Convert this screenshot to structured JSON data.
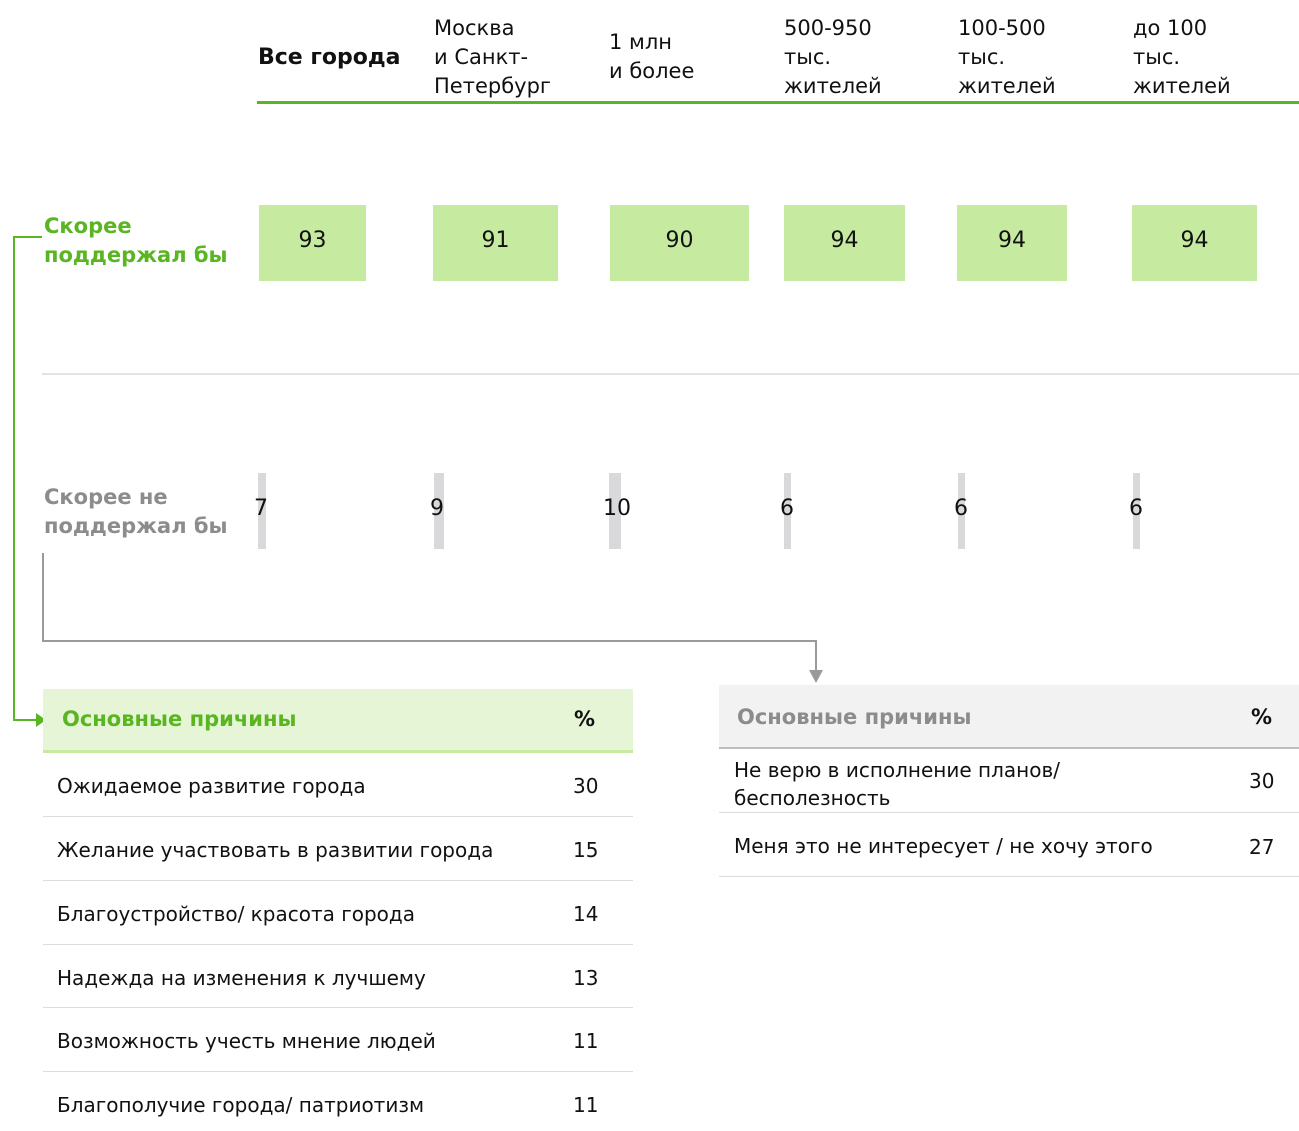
{
  "colors": {
    "green": "#5ab522",
    "green_light": "#c6eaa0",
    "green_header": "#e6f5d5",
    "gray_text": "#8c8c8c",
    "gray_bar": "#d9d9db",
    "gray_header": "#f2f2f2"
  },
  "header": {
    "columns": [
      [
        "Все города"
      ],
      [
        "Москва",
        "и Санкт-",
        "Петербург"
      ],
      [
        "1 млн",
        "и более"
      ],
      [
        "500-950",
        "тыс.",
        "жителей"
      ],
      [
        "100-500",
        "тыс.",
        "жителей"
      ],
      [
        "до 100",
        "тыс.",
        "жителей"
      ]
    ]
  },
  "rows": {
    "support_label": [
      "Скорее",
      "поддержал бы"
    ],
    "oppose_label": [
      "Скорее не",
      "поддержал бы"
    ]
  },
  "chart_data": {
    "type": "bar",
    "categories": [
      "Все города",
      "Москва и Санкт-Петербург",
      "1 млн и более",
      "500-950 тыс. жителей",
      "100-500 тыс. жителей",
      "до 100 тыс. жителей"
    ],
    "series": [
      {
        "name": "Скорее поддержал бы",
        "values": [
          93,
          91,
          90,
          94,
          94,
          94
        ]
      },
      {
        "name": "Скорее не поддержал бы",
        "values": [
          7,
          9,
          10,
          6,
          6,
          6
        ]
      }
    ]
  },
  "reasons_support": {
    "title": "Основные причины",
    "pct_label": "%",
    "items": [
      {
        "text": "Ожидаемое развитие города",
        "value": "30"
      },
      {
        "text": "Желание участвовать в развитии города",
        "value": "15"
      },
      {
        "text": "Благоустройство/ красота города",
        "value": "14"
      },
      {
        "text": "Надежда на изменения к лучшему",
        "value": "13"
      },
      {
        "text": "Возможность учесть мнение людей",
        "value": "11"
      },
      {
        "text": "Благополучие города/ патриотизм",
        "value": "11"
      }
    ]
  },
  "reasons_oppose": {
    "title": "Основные причины",
    "pct_label": "%",
    "items": [
      {
        "text": [
          "Не верю в исполнение планов/",
          "бесполезность"
        ],
        "value": "30"
      },
      {
        "text": [
          "Меня это не интересует / не хочу этого"
        ],
        "value": "27"
      }
    ]
  }
}
